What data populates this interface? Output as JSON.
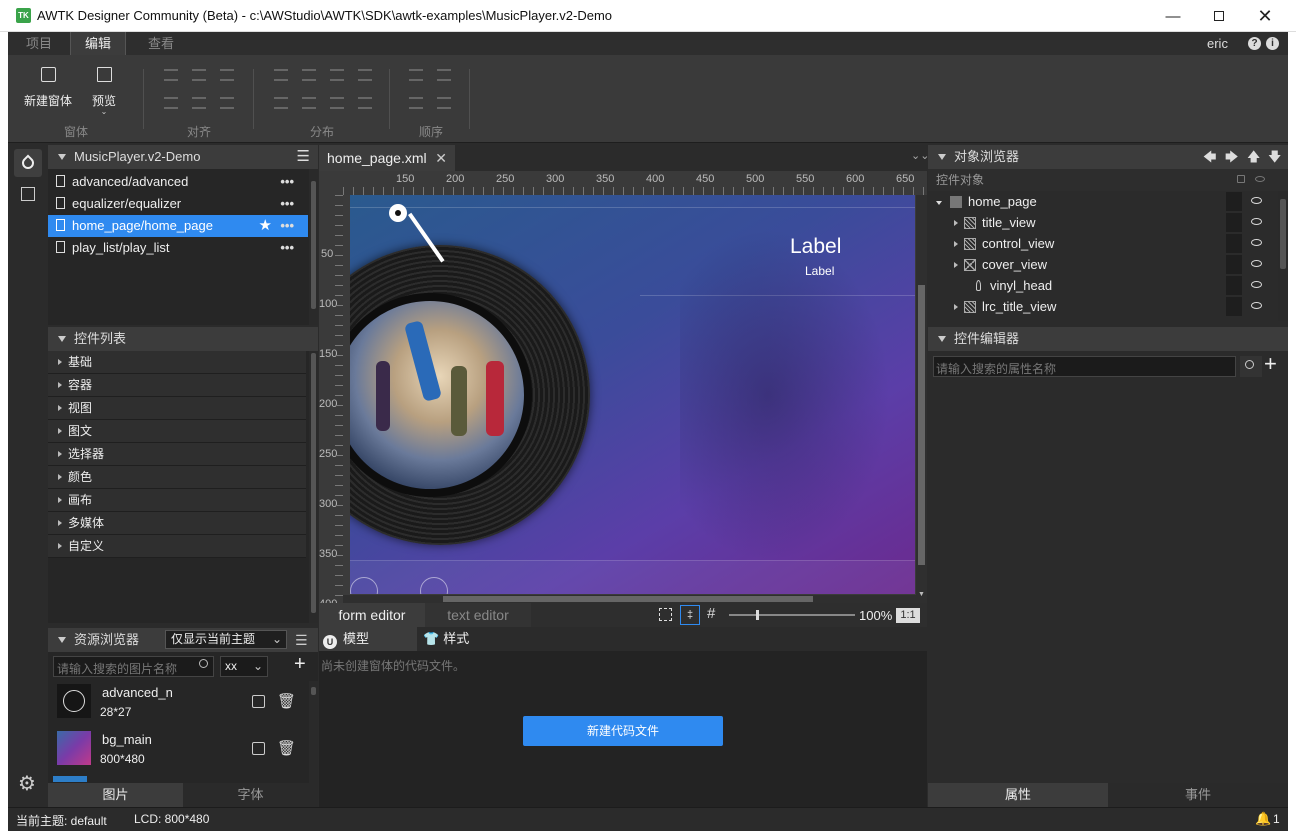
{
  "window": {
    "title": "AWTK Designer Community (Beta) - c:\\AWStudio\\AWTK\\SDK\\awtk-examples\\MusicPlayer.v2-Demo",
    "logo_text": "TK"
  },
  "menu": {
    "tabs": [
      "项目",
      "编辑",
      "查看"
    ],
    "active": "编辑",
    "user": "eric"
  },
  "ribbon": {
    "new_window": "新建窗体",
    "preview": "预览",
    "groups": [
      "窗体",
      "对齐",
      "分布",
      "顺序"
    ]
  },
  "project": {
    "name": "MusicPlayer.v2-Demo",
    "items": [
      {
        "label": "advanced/advanced",
        "selected": false
      },
      {
        "label": "equalizer/equalizer",
        "selected": false
      },
      {
        "label": "home_page/home_page",
        "selected": true
      },
      {
        "label": "play_list/play_list",
        "selected": false
      }
    ]
  },
  "controls": {
    "title": "控件列表",
    "items": [
      "基础",
      "容器",
      "视图",
      "图文",
      "选择器",
      "颜色",
      "画布",
      "多媒体",
      "自定义"
    ]
  },
  "resources": {
    "title": "资源浏览器",
    "filter": "仅显示当前主题",
    "search_placeholder": "请输入搜索的图片名称",
    "size_select": "xx",
    "items": [
      {
        "name": "advanced_n",
        "size": "28*27"
      },
      {
        "name": "bg_main",
        "size": "800*480"
      }
    ],
    "tabs": [
      "图片",
      "字体"
    ]
  },
  "editor": {
    "tab": "home_page.xml",
    "ruler_h": [
      "150",
      "200",
      "250",
      "300",
      "350",
      "400",
      "450",
      "500",
      "550",
      "600",
      "650"
    ],
    "ruler_v": [
      "50",
      "100",
      "150",
      "200",
      "250",
      "300",
      "350",
      "400"
    ],
    "stage_label_big": "Label",
    "stage_label_small": "Label",
    "modes": [
      "form editor",
      "text editor"
    ],
    "zoom": "100%",
    "ratio": "1:1"
  },
  "code": {
    "tabs": [
      "模型",
      "样式"
    ],
    "message": "尚未创建窗体的代码文件。",
    "create_button": "新建代码文件"
  },
  "objects": {
    "title": "对象浏览器",
    "column": "控件对象",
    "root": "home_page",
    "children": [
      "title_view",
      "control_view",
      "cover_view",
      "vinyl_head",
      "lrc_title_view"
    ]
  },
  "prop_editor": {
    "title": "控件编辑器",
    "search_placeholder": "请输入搜索的属性名称",
    "tabs": [
      "属性",
      "事件"
    ]
  },
  "status": {
    "theme": "当前主题: default",
    "lcd": "LCD: 800*480",
    "notifications": "1"
  },
  "colors": {
    "accent": "#2f8af0",
    "button": "#2f8af0"
  }
}
